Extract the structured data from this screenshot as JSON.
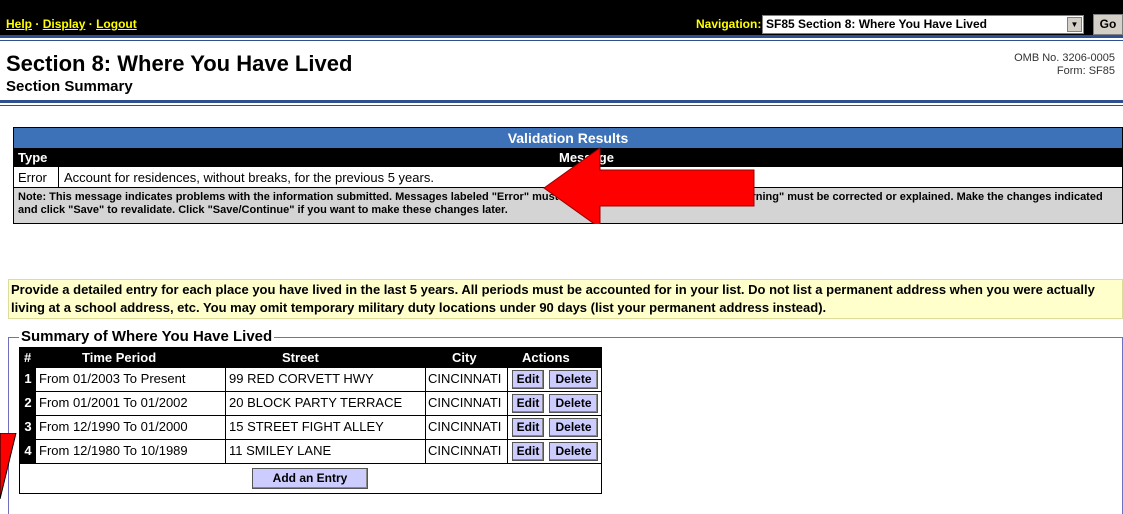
{
  "top_bar": {
    "links": [
      "Help",
      "Display",
      "Logout"
    ],
    "separator": "·",
    "navigation_label": "Navigation:",
    "navigation_value": "SF85 Section 8: Where You Have Lived",
    "go_label": "Go"
  },
  "header": {
    "title": "Section 8: Where You Have Lived",
    "subtitle": "Section Summary",
    "omb_line1": "OMB No. 3206-0005",
    "omb_line2": "Form: SF85"
  },
  "validation": {
    "title": "Validation Results",
    "col_type": "Type",
    "col_message": "Message",
    "row_type": "Error",
    "row_message": "Account for residences, without breaks, for the previous 5 years.",
    "note": "Note: This message indicates problems with the information submitted. Messages labeled \"Error\" must be corrected. Messages labeled \"Warning\" must be corrected or explained. Make the changes indicated and click \"Save\" to revalidate. Click \"Save/Continue\" if you want to make these changes later."
  },
  "instructions": "Provide a detailed entry for each place you have lived in the last 5 years. All periods must be accounted for in your list. Do not list a permanent address when you were actually living at a school address, etc. You may omit temporary military duty locations under 90 days (list your permanent address instead).",
  "summary": {
    "legend": "Summary of Where You Have Lived",
    "headers": {
      "num": "#",
      "period": "Time Period",
      "street": "Street",
      "city": "City",
      "actions": "Actions"
    },
    "rows": [
      {
        "num": "1",
        "period": "From 01/2003 To Present",
        "street": "99 RED CORVETT HWY",
        "city": "CINCINNATI"
      },
      {
        "num": "2",
        "period": "From 01/2001 To 01/2002",
        "street": "20 BLOCK PARTY TERRACE",
        "city": "CINCINNATI"
      },
      {
        "num": "3",
        "period": "From 12/1990 To 01/2000",
        "street": "15 STREET FIGHT ALLEY",
        "city": "CINCINNATI"
      },
      {
        "num": "4",
        "period": "From 12/1980 To 10/1989",
        "street": "11 SMILEY LANE",
        "city": "CINCINNATI"
      }
    ],
    "edit_label": "Edit",
    "delete_label": "Delete",
    "add_label": "Add an Entry"
  },
  "colors": {
    "top_bar": "#000000",
    "link_yellow": "#ffff00",
    "validation_blue": "#3d72b8",
    "instruction_bg": "#ffffcc",
    "button_bg": "#ccccff",
    "annotation_red": "#ff0000"
  }
}
